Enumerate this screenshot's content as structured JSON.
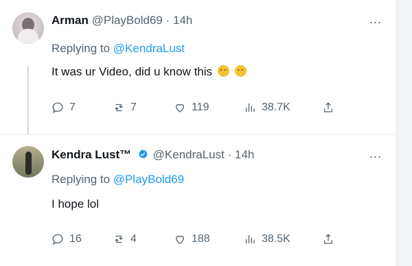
{
  "tweets": [
    {
      "name": "Arman",
      "handle": "@PlayBold69",
      "time": "14h",
      "replying_to_label": "Replying to",
      "replying_to_handle": "@KendraLust",
      "text": "It was ur Video, did u know this",
      "emojis": [
        "sweat-smile-emoji",
        "blush-emoji"
      ],
      "stats": {
        "replies": "7",
        "retweets": "7",
        "likes": "119",
        "views": "38.7K"
      },
      "more": "..."
    },
    {
      "name": "Kendra Lust™",
      "verified": true,
      "handle": "@KendraLust",
      "time": "14h",
      "replying_to_label": "Replying to",
      "replying_to_handle": "@PlayBold69",
      "text": "I hope lol",
      "stats": {
        "replies": "16",
        "retweets": "4",
        "likes": "188",
        "views": "38.5K"
      },
      "more": "..."
    }
  ],
  "separator_dot": "·",
  "colors": {
    "link": "#1d9bf0",
    "muted": "#536471",
    "text": "#0f1419",
    "verified": "#1d9bf0"
  },
  "icons": [
    "reply-icon",
    "retweet-icon",
    "like-icon",
    "views-icon",
    "share-icon",
    "more-icon",
    "verified-badge-icon"
  ]
}
